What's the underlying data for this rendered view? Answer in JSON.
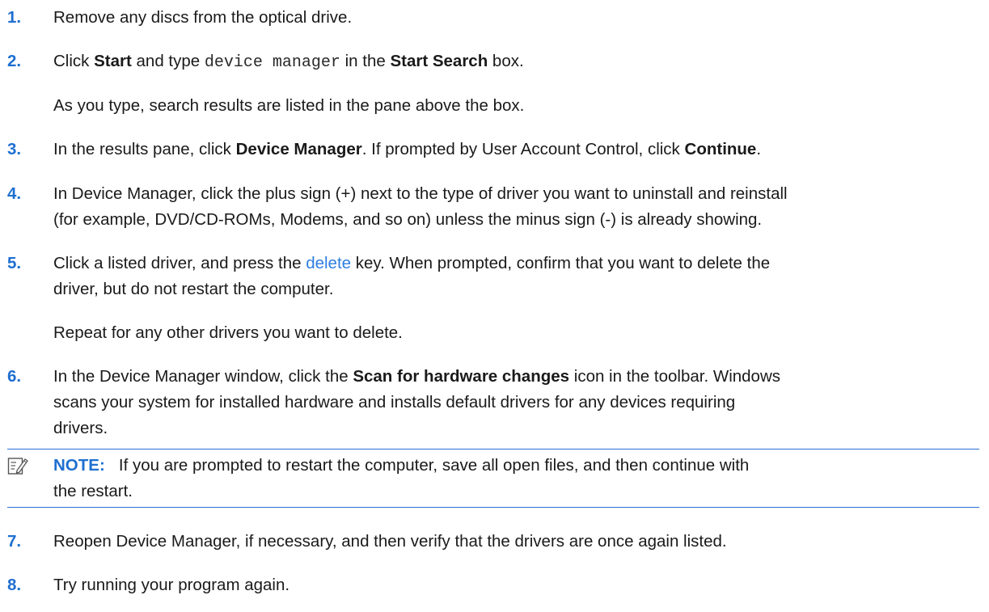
{
  "steps": [
    {
      "num": "1.",
      "text": "Remove any discs from the optical drive."
    },
    {
      "num": "2.",
      "pre": "Click ",
      "bold1": "Start",
      "mid": " and type ",
      "code": "device manager",
      "mid2": " in the ",
      "bold2": "Start Search",
      "post": " box.",
      "sub": "As you type, search results are listed in the pane above the box."
    },
    {
      "num": "3.",
      "pre": "In the results pane, click ",
      "bold1": "Device Manager",
      "mid": ". If prompted by User Account Control, click ",
      "bold2": "Continue",
      "post": "."
    },
    {
      "num": "4.",
      "line1": "In Device Manager, click the plus sign (+) next to the type of driver you want to uninstall and reinstall",
      "line2": "(for example, DVD/CD-ROMs, Modems, and so on) unless the minus sign (-) is already showing."
    },
    {
      "num": "5.",
      "pre": "Click a listed driver, and press the ",
      "key": "delete",
      "post1": " key. When prompted, confirm that you want to delete the",
      "line2": "driver, but do not restart the computer.",
      "sub": "Repeat for any other drivers you want to delete."
    },
    {
      "num": "6.",
      "pre": "In the Device Manager window, click the ",
      "bold1": "Scan for hardware changes",
      "post1": " icon in the toolbar. Windows",
      "line2": "scans your system for installed hardware and installs default drivers for any devices requiring",
      "line3": "drivers."
    },
    {
      "num": "7.",
      "text": "Reopen Device Manager, if necessary, and then verify that the drivers are once again listed."
    },
    {
      "num": "8.",
      "text": "Try running your program again."
    }
  ],
  "note": {
    "label": "NOTE:",
    "line1": "If you are prompted to restart the computer, save all open files, and then continue with",
    "line2": "the restart.",
    "icon": "note-pencil-icon"
  },
  "colors": {
    "accent": "#1e6fd0",
    "text": "#1a1a1a",
    "key_link": "#2d7ee0"
  }
}
